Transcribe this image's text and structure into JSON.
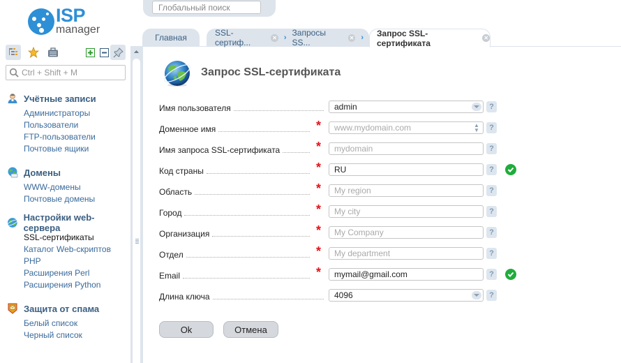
{
  "logo": {
    "brand": "ISP",
    "product": "manager",
    "color": "#2d8fd6"
  },
  "toolbar": {
    "buttons": [
      "tree-view",
      "favorites",
      "briefcase",
      "expand-all",
      "collapse-all",
      "pin"
    ]
  },
  "menu_search": {
    "placeholder": "Ctrl + Shift + M"
  },
  "global_search": {
    "placeholder": "Глобальный поиск"
  },
  "nav": {
    "groups": [
      {
        "title": "Учётные записи",
        "icon": "user-icon",
        "items": [
          "Администраторы",
          "Пользователи",
          "FTP-пользователи",
          "Почтовые ящики"
        ]
      },
      {
        "title": "Домены",
        "icon": "domain-globe-icon",
        "items": [
          "WWW-домены",
          "Почтовые домены"
        ]
      },
      {
        "title": "Настройки web-сервера",
        "icon": "web-server-globe-icon",
        "items": [
          "SSL-сертификаты",
          "Каталог Web-скриптов",
          "PHP",
          "Расширения Perl",
          "Расширения Python"
        ]
      },
      {
        "title": "Защита от спама",
        "icon": "spam-shield-icon",
        "items": [
          "Белый список",
          "Черный список"
        ]
      }
    ],
    "current_item": "SSL-сертификаты"
  },
  "tabs": {
    "home": "Главная",
    "crumbs": [
      "SSL-сертиф...",
      "Запросы SS..."
    ],
    "active": "Запрос SSL-сертификата"
  },
  "form": {
    "title": "Запрос SSL-сертификата",
    "fields": [
      {
        "label": "Имя пользователя",
        "required": false,
        "type": "select",
        "value": "admin",
        "placeholder": "",
        "valid": false
      },
      {
        "label": "Доменное имя",
        "required": true,
        "type": "text-spin",
        "value": "",
        "placeholder": "www.mydomain.com",
        "valid": false
      },
      {
        "label": "Имя запроса SSL-сертификата",
        "required": true,
        "type": "text",
        "value": "",
        "placeholder": "mydomain",
        "valid": false
      },
      {
        "label": "Код страны",
        "required": true,
        "type": "text",
        "value": "RU",
        "placeholder": "",
        "valid": true
      },
      {
        "label": "Область",
        "required": true,
        "type": "text",
        "value": "",
        "placeholder": "My region",
        "valid": false
      },
      {
        "label": "Город",
        "required": true,
        "type": "text",
        "value": "",
        "placeholder": "My city",
        "valid": false
      },
      {
        "label": "Организация",
        "required": true,
        "type": "text",
        "value": "",
        "placeholder": "My Company",
        "valid": false
      },
      {
        "label": "Отдел",
        "required": true,
        "type": "text",
        "value": "",
        "placeholder": "My department",
        "valid": false
      },
      {
        "label": "Email",
        "required": true,
        "type": "text",
        "value": "mymail@gmail.com",
        "placeholder": "",
        "valid": true
      },
      {
        "label": "Длина ключа",
        "required": false,
        "type": "select",
        "value": "4096",
        "placeholder": "",
        "valid": false
      }
    ],
    "help_label": "?",
    "required_mark": "*",
    "ok_label": "Ok",
    "cancel_label": "Отмена"
  },
  "colors": {
    "accent": "#2d8fd6",
    "nav_link": "#3a6a9a",
    "required": "#e4141b",
    "valid": "#20ac3b",
    "panel": "#dde4ec"
  }
}
